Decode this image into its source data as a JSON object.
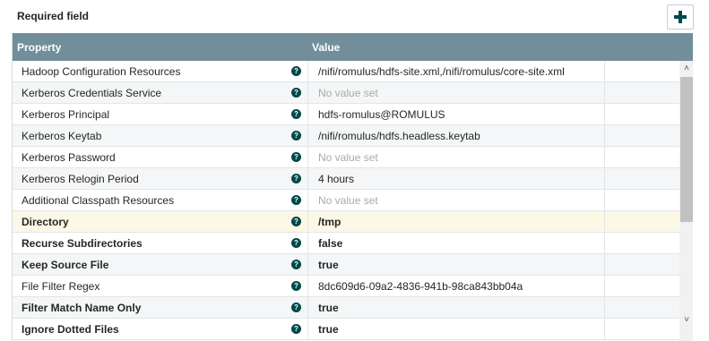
{
  "required_label": "Required field",
  "add_button_icon": "plus-icon",
  "colors": {
    "header_bg": "#728e9b",
    "selected_row": "#fcf8e6",
    "help_icon": "#004849",
    "placeholder_text": "#aaaaaa"
  },
  "table": {
    "headers": {
      "property": "Property",
      "value": "Value"
    },
    "rows": [
      {
        "property": "Hadoop Configuration Resources",
        "value": "/nifi/romulus/hdfs-site.xml,/nifi/romulus/core-site.xml",
        "required": false,
        "unset": false
      },
      {
        "property": "Kerberos Credentials Service",
        "value": "No value set",
        "required": false,
        "unset": true
      },
      {
        "property": "Kerberos Principal",
        "value": "hdfs-romulus@ROMULUS",
        "required": false,
        "unset": false
      },
      {
        "property": "Kerberos Keytab",
        "value": "/nifi/romulus/hdfs.headless.keytab",
        "required": false,
        "unset": false
      },
      {
        "property": "Kerberos Password",
        "value": "No value set",
        "required": false,
        "unset": true
      },
      {
        "property": "Kerberos Relogin Period",
        "value": "4 hours",
        "required": false,
        "unset": false
      },
      {
        "property": "Additional Classpath Resources",
        "value": "No value set",
        "required": false,
        "unset": true
      },
      {
        "property": "Directory",
        "value": "/tmp",
        "required": true,
        "unset": false,
        "selected": true
      },
      {
        "property": "Recurse Subdirectories",
        "value": "false",
        "required": true,
        "unset": false
      },
      {
        "property": "Keep Source File",
        "value": "true",
        "required": true,
        "unset": false
      },
      {
        "property": "File Filter Regex",
        "value": "8dc609d6-09a2-4836-941b-98ca843bb04a",
        "required": false,
        "unset": false
      },
      {
        "property": "Filter Match Name Only",
        "value": "true",
        "required": true,
        "unset": false
      },
      {
        "property": "Ignore Dotted Files",
        "value": "true",
        "required": true,
        "unset": false
      }
    ]
  },
  "help_glyph": "?",
  "scroll": {
    "up_glyph": "˄",
    "down_glyph": "˅"
  }
}
